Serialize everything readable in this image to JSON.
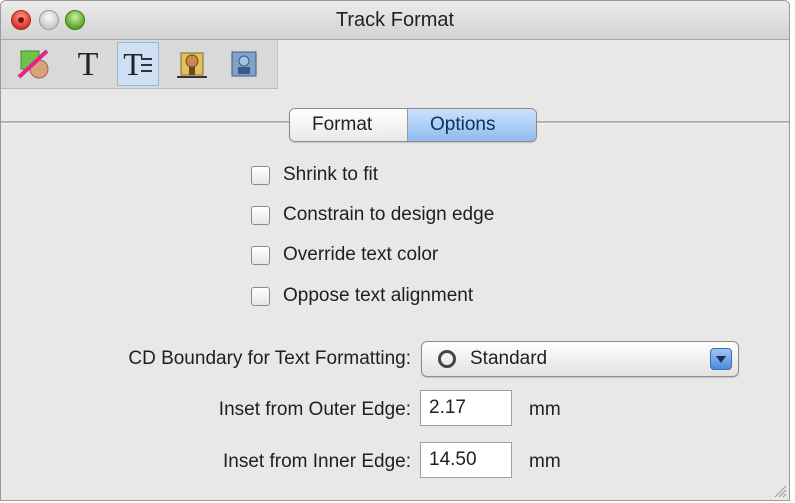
{
  "window": {
    "title": "Track Format"
  },
  "toolbar": {
    "items": [
      {
        "icon": "fill-stroke-icon"
      },
      {
        "icon": "text-icon",
        "glyph": "T"
      },
      {
        "icon": "text-format-icon",
        "glyph": "T",
        "active": true
      },
      {
        "icon": "image-position-icon"
      },
      {
        "icon": "photo-adjust-icon"
      }
    ]
  },
  "tabs": {
    "format": "Format",
    "options": "Options",
    "selected": "Options"
  },
  "options": {
    "shrink_to_fit": "Shrink to fit",
    "constrain_to_edge": "Constrain to design edge",
    "override_color": "Override text color",
    "oppose_alignment": "Oppose text alignment"
  },
  "boundary": {
    "label": "CD Boundary for Text Formatting:",
    "value": "Standard"
  },
  "inset_outer": {
    "label": "Inset from Outer Edge:",
    "value": "2.17",
    "unit": "mm"
  },
  "inset_inner": {
    "label": "Inset from Inner Edge:",
    "value": "14.50",
    "unit": "mm"
  },
  "colors": {
    "accent": "#8fbcef",
    "close": "#d9362a",
    "zoom": "#5aa42a"
  }
}
